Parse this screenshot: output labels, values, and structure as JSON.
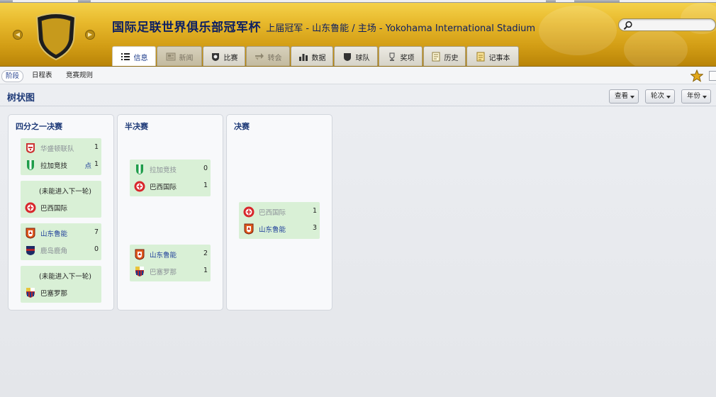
{
  "header": {
    "title": "国际足联世界俱乐部冠军杯",
    "subtitle": "上届冠军 - 山东鲁能 / 主场 - Yokohama International Stadium",
    "search_placeholder": ""
  },
  "tabs": [
    {
      "label": "信息",
      "icon": "list-icon",
      "state": "active"
    },
    {
      "label": "新闻",
      "icon": "newspaper-icon",
      "state": "disabled"
    },
    {
      "label": "比赛",
      "icon": "shield-ball-icon",
      "state": "normal"
    },
    {
      "label": "转会",
      "icon": "transfer-arrows-icon",
      "state": "disabled"
    },
    {
      "label": "数据",
      "icon": "bar-chart-icon",
      "state": "normal"
    },
    {
      "label": "球队",
      "icon": "shield-icon",
      "state": "normal"
    },
    {
      "label": "奖项",
      "icon": "trophy-icon",
      "state": "normal"
    },
    {
      "label": "历史",
      "icon": "document-icon",
      "state": "normal"
    },
    {
      "label": "记事本",
      "icon": "notepad-icon",
      "state": "normal"
    }
  ],
  "subnav": [
    {
      "label": "阶段",
      "active": true
    },
    {
      "label": "日程表",
      "active": false
    },
    {
      "label": "竞赛规则",
      "active": false
    }
  ],
  "page_title": "树状图",
  "dropdowns": [
    "查看",
    "轮次",
    "年份"
  ],
  "bracket": {
    "columns": [
      {
        "title": "四分之一决赛",
        "matches": [
          {
            "rows": [
              {
                "team": "华盛顿联队",
                "score": "1",
                "badge": "stars-crest",
                "status": "lost"
              },
              {
                "team": "拉加竞技",
                "score": "1",
                "pen": "点",
                "badge": "green-white-crest",
                "status": "won"
              }
            ]
          },
          {
            "rows": [
              {
                "note": "(未能进入下一轮)"
              },
              {
                "team": "巴西国际",
                "badge": "red-round-crest",
                "status": "won"
              }
            ]
          },
          {
            "rows": [
              {
                "team": "山东鲁能",
                "score": "7",
                "badge": "orange-red-crest",
                "status": "link"
              },
              {
                "team": "鹿岛鹿角",
                "score": "0",
                "badge": "navy-red-crest",
                "status": "lost"
              }
            ]
          },
          {
            "rows": [
              {
                "note": "(未能进入下一轮)"
              },
              {
                "team": "巴塞罗那",
                "badge": "barca-crest",
                "status": "won"
              }
            ]
          }
        ]
      },
      {
        "title": "半决赛",
        "matches": [
          {
            "rows": [
              {
                "team": "拉加竞技",
                "score": "0",
                "badge": "green-white-crest",
                "status": "lost"
              },
              {
                "team": "巴西国际",
                "score": "1",
                "badge": "red-round-crest",
                "status": "won"
              }
            ]
          },
          {
            "rows": [
              {
                "team": "山东鲁能",
                "score": "2",
                "badge": "orange-red-crest",
                "status": "link"
              },
              {
                "team": "巴塞罗那",
                "score": "1",
                "badge": "barca-crest",
                "status": "lost"
              }
            ]
          }
        ]
      },
      {
        "title": "决赛",
        "matches": [
          {
            "rows": [
              {
                "team": "巴西国际",
                "score": "1",
                "badge": "red-round-crest",
                "status": "lost"
              },
              {
                "team": "山东鲁能",
                "score": "3",
                "badge": "orange-red-crest",
                "status": "link"
              }
            ]
          }
        ]
      }
    ]
  }
}
